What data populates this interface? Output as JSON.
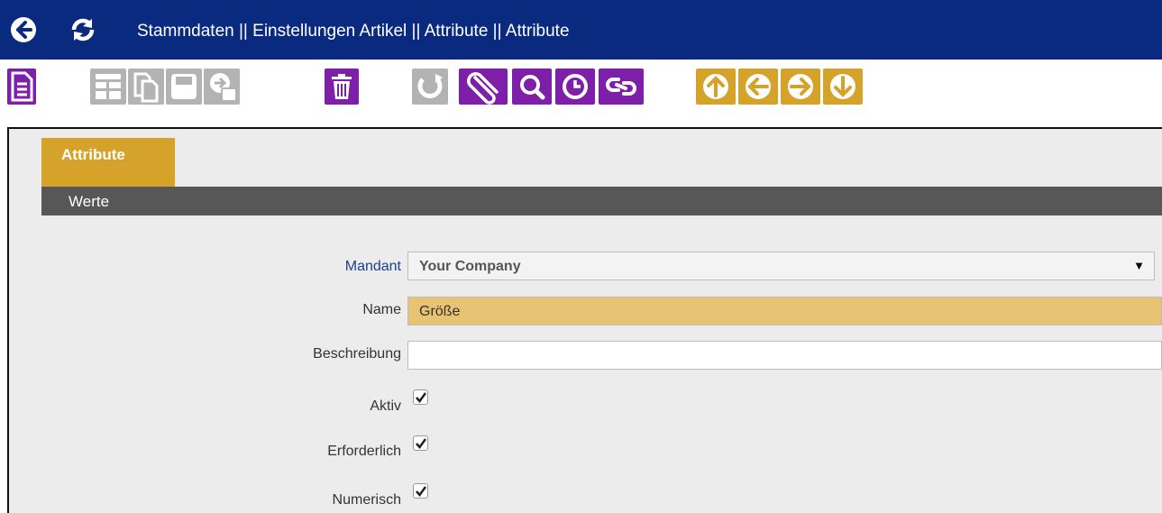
{
  "titlebar": {
    "breadcrumb": "Stammdaten || Einstellungen Artikel || Attribute  ||  Attribute",
    "back_icon": "back-arrow-icon",
    "refresh_icon": "refresh-icon"
  },
  "toolbar": {
    "buttons": [
      {
        "name": "new-record",
        "icon": "new-document-icon",
        "color": "#7d1fa8"
      },
      {
        "name": "grid-toggle",
        "icon": "grid-icon",
        "color": "#b3b3b3"
      },
      {
        "name": "copy-record",
        "icon": "copy-icon",
        "color": "#b3b3b3"
      },
      {
        "name": "save",
        "icon": "save-icon",
        "color": "#b3b3b3"
      },
      {
        "name": "save-and-new",
        "icon": "save-new-icon",
        "color": "#b3b3b3"
      },
      {
        "name": "delete",
        "icon": "trash-icon",
        "color": "#7d1fa8"
      },
      {
        "name": "undo",
        "icon": "undo-icon",
        "color": "#b3b3b3"
      },
      {
        "name": "attachment",
        "icon": "paperclip-icon",
        "color": "#7d1fa8"
      },
      {
        "name": "search",
        "icon": "search-icon",
        "color": "#7d1fa8"
      },
      {
        "name": "history",
        "icon": "clock-icon",
        "color": "#7d1fa8"
      },
      {
        "name": "link",
        "icon": "link-icon",
        "color": "#7d1fa8"
      },
      {
        "name": "first-record",
        "icon": "arrow-up-icon",
        "color": "#d6a32a"
      },
      {
        "name": "previous-record",
        "icon": "arrow-left-icon",
        "color": "#d6a32a"
      },
      {
        "name": "next-record",
        "icon": "arrow-right-icon",
        "color": "#d6a32a"
      },
      {
        "name": "last-record",
        "icon": "arrow-down-icon",
        "color": "#d6a32a"
      }
    ]
  },
  "tabs": {
    "active": "Attribute"
  },
  "section": {
    "title": "Werte"
  },
  "form": {
    "mandant": {
      "label": "Mandant",
      "value": "Your Company",
      "arrow": "▼"
    },
    "name": {
      "label": "Name",
      "value": "Größe"
    },
    "beschreibung": {
      "label": "Beschreibung",
      "value": ""
    },
    "aktiv": {
      "label": "Aktiv",
      "checked": true
    },
    "erforderlich": {
      "label": "Erforderlich",
      "checked": true
    },
    "numerisch": {
      "label": "Numerisch",
      "checked": true
    }
  }
}
